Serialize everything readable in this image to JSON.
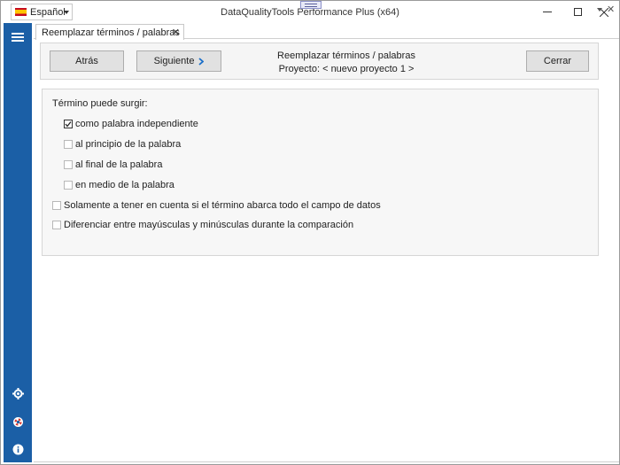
{
  "window": {
    "title": "DataQualityTools Performance Plus (x64)",
    "language": "Español"
  },
  "sidebar": {
    "accent_color": "#1b5fa6",
    "icons": [
      "menu-icon",
      "gear-icon",
      "lifebuoy-icon",
      "info-icon"
    ]
  },
  "tab": {
    "label": "Reemplazar términos / palabras",
    "close": "✕"
  },
  "header": {
    "back_label": "Atrás",
    "next_label": "Siguiente",
    "close_label": "Cerrar",
    "title": "Reemplazar términos / palabras",
    "project": "Proyecto: < nuevo proyecto 1 >"
  },
  "options": {
    "section_label": "Término puede surgir:",
    "items": [
      {
        "label": "como palabra independiente",
        "checked": true
      },
      {
        "label": "al principio de la palabra",
        "checked": false
      },
      {
        "label": "al final de la palabra",
        "checked": false
      },
      {
        "label": "en medio de la palabra",
        "checked": false
      },
      {
        "label": "Solamente a tener en cuenta si el término abarca todo el campo de datos",
        "checked": false
      },
      {
        "label": "Diferenciar entre mayúsculas y minúsculas durante la comparación",
        "checked": false
      }
    ]
  }
}
